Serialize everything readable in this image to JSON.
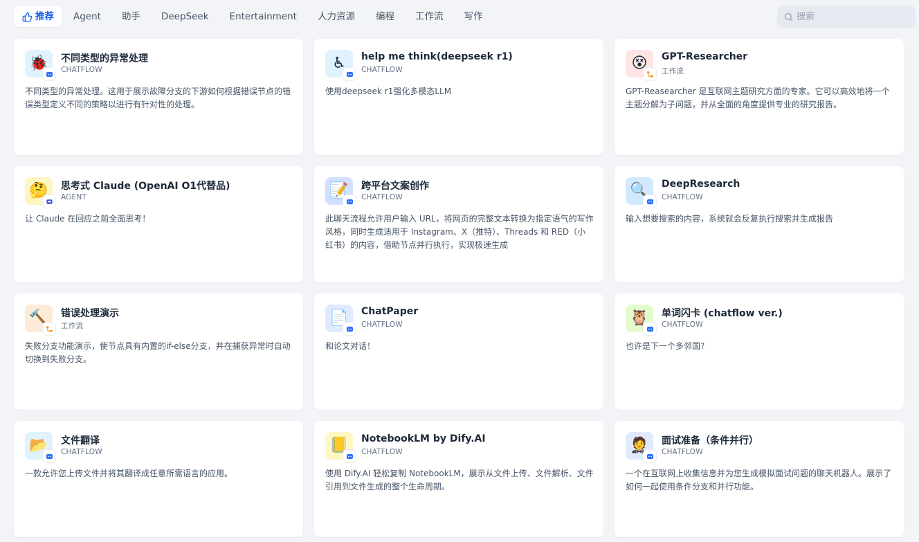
{
  "tabs": [
    {
      "label": "推荐",
      "active": true
    },
    {
      "label": "Agent"
    },
    {
      "label": "助手"
    },
    {
      "label": "DeepSeek"
    },
    {
      "label": "Entertainment"
    },
    {
      "label": "人力资源"
    },
    {
      "label": "编程"
    },
    {
      "label": "工作流"
    },
    {
      "label": "写作"
    }
  ],
  "search": {
    "placeholder": "搜索"
  },
  "colors": {
    "accent": "#155eef",
    "badge_blue": "#2970ff",
    "badge_orange": "#f79009",
    "badge_indigo": "#444ce7"
  },
  "cards": [
    {
      "title": "不同类型的异常处理",
      "type": "CHATFLOW",
      "desc": "不同类型的异常处理。这用于展示故障分支的下游如何根据错误节点的错误类型定义不同的策略以进行有针对性的处理。",
      "icon": "ladybug-icon",
      "glyph": "🐞",
      "bg": "#e0f2fe",
      "badge": "chatflow"
    },
    {
      "title": "help me think(deepseek r1)",
      "type": "CHATFLOW",
      "desc": "使用deepseek r1强化多模态LLM",
      "icon": "wheelchair-icon",
      "glyph": "♿",
      "bg": "#e0f2fe",
      "badge": "chatflow"
    },
    {
      "title": "GPT-Researcher",
      "type": "工作流",
      "desc": "GPT-Reasearcher 是互联网主题研究方面的专家。它可以高效地将一个主题分解为子问题，并从全面的角度提供专业的研究报告。",
      "icon": "dizzy-face-icon",
      "glyph": "😵",
      "bg": "#fee4e2",
      "badge": "workflow"
    },
    {
      "title": "思考式 Claude (OpenAI O1代替品)",
      "type": "AGENT",
      "desc": "让 Claude 在回应之前全面思考！",
      "icon": "thinking-face-icon",
      "glyph": "🤔",
      "bg": "#fef7c3",
      "badge": "agent"
    },
    {
      "title": "跨平台文案创作",
      "type": "CHATFLOW",
      "desc": "此聊天流程允许用户输入 URL，将网页的完整文本转换为指定语气的写作风格，同时生成适用于 Instagram、X（推特）、Threads 和 RED（小红书）的内容，借助节点并行执行，实现极速生成",
      "icon": "memo-icon",
      "glyph": "📝",
      "bg": "#d1e0ff",
      "badge": "chatflow"
    },
    {
      "title": "DeepResearch",
      "type": "CHATFLOW",
      "desc": "输入想要搜索的内容，系统就会反复执行搜索并生成报告",
      "icon": "magnifier-icon",
      "glyph": "🔍",
      "bg": "#d1e9ff",
      "badge": "chatflow"
    },
    {
      "title": "错误处理演示",
      "type": "工作流",
      "desc": "失败分支功能演示，使节点具有内置的if-else分支，并在捕获异常时自动切换到失败分支。",
      "icon": "hammer-icon",
      "glyph": "🔨",
      "bg": "#fdead7",
      "badge": "workflow"
    },
    {
      "title": "ChatPaper",
      "type": "CHATFLOW",
      "desc": "和论文对话！",
      "icon": "document-icon",
      "glyph": "📄",
      "bg": "#e0eaff",
      "badge": "chatflow"
    },
    {
      "title": "单词闪卡 (chatflow ver.)",
      "type": "CHATFLOW",
      "desc": "也许是下一个多邻国?",
      "icon": "owl-icon",
      "glyph": "🦉",
      "bg": "#e3fbcc",
      "badge": "chatflow"
    },
    {
      "title": "文件翻译",
      "type": "CHATFLOW",
      "desc": "一款允许您上传文件并将其翻译成任意所需语言的应用。",
      "icon": "folder-icon",
      "glyph": "📂",
      "bg": "#e0f2fe",
      "badge": "chatflow"
    },
    {
      "title": "NotebookLM by Dify.AI",
      "type": "CHATFLOW",
      "desc": "使用 Dify.AI 轻松复制 NotebookLM，展示从文件上传、文件解析、文件引用到文件生成的整个生命周期。",
      "icon": "notebook-icon",
      "glyph": "📒",
      "bg": "#fef7c3",
      "badge": "chatflow"
    },
    {
      "title": "面试准备（条件并行）",
      "type": "CHATFLOW",
      "desc": "一个在互联网上收集信息并为您生成模拟面试问题的聊天机器人。展示了如何一起使用条件分支和并行功能。",
      "icon": "businessman-icon",
      "glyph": "🤵",
      "bg": "#e0eaff",
      "badge": "chatflow"
    }
  ]
}
